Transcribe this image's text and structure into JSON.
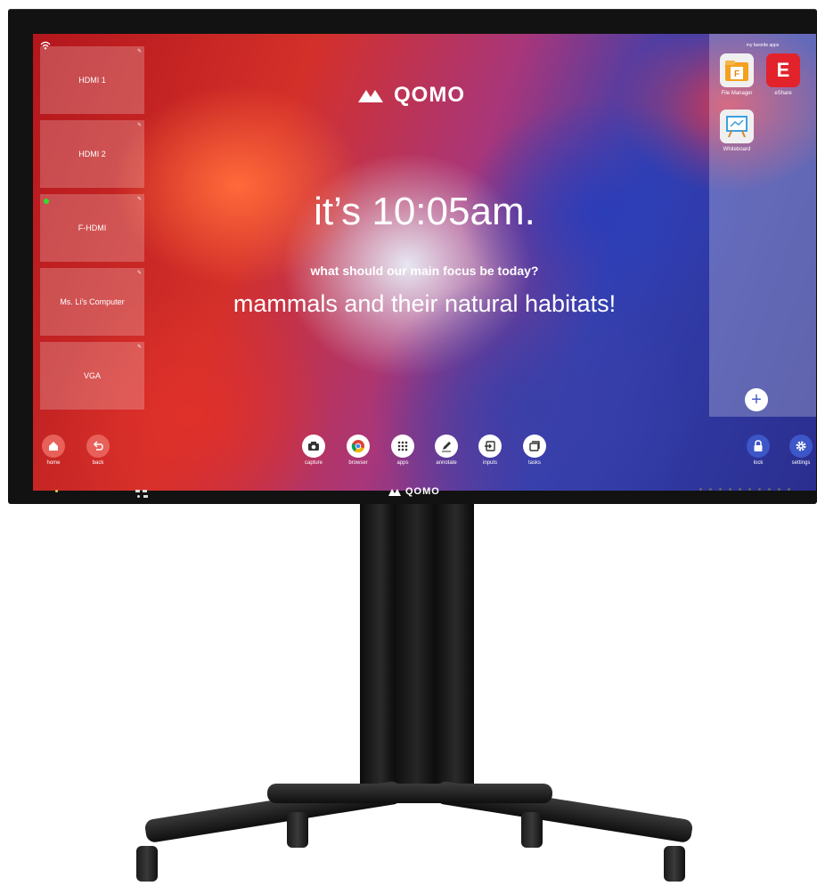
{
  "screen": {
    "brand": "QOMO",
    "greeting_time": "it’s 10:05am.",
    "question": "what should our main focus be today?",
    "answer": "mammals and their natural habitats!"
  },
  "inputs": [
    {
      "label": "HDMI 1",
      "active": false
    },
    {
      "label": "HDMI 2",
      "active": false
    },
    {
      "label": "F-HDMI",
      "active": true
    },
    {
      "label": "Ms. Li’s Computer",
      "active": false
    },
    {
      "label": "VGA",
      "active": false
    }
  ],
  "apps_panel": {
    "title": "my favorite apps",
    "apps": [
      {
        "label": "File Manager",
        "icon": "folder-icon",
        "color": "#f4a020"
      },
      {
        "label": "eShare",
        "icon": "eshare-icon",
        "color": "#e2232b"
      },
      {
        "label": "Whiteboard",
        "icon": "whiteboard-icon",
        "color": "#3da0e0"
      }
    ]
  },
  "dock_left": [
    {
      "label": "home",
      "icon": "home-icon"
    },
    {
      "label": "back",
      "icon": "back-icon"
    }
  ],
  "dock_center": [
    {
      "label": "capture",
      "icon": "camera-icon"
    },
    {
      "label": "browser",
      "icon": "chrome-icon"
    },
    {
      "label": "apps",
      "icon": "grid-icon"
    },
    {
      "label": "annotate",
      "icon": "pen-icon"
    },
    {
      "label": "inputs",
      "icon": "input-icon"
    },
    {
      "label": "tasks",
      "icon": "tasks-icon"
    }
  ],
  "dock_right": [
    {
      "label": "lock",
      "icon": "lock-icon"
    },
    {
      "label": "settings",
      "icon": "gear-icon"
    }
  ],
  "bezel": {
    "brand": "QOMO"
  },
  "colors": {
    "accent": "#3d56c8",
    "active_input": "#2ee02e",
    "home_button": "#e8605a"
  }
}
